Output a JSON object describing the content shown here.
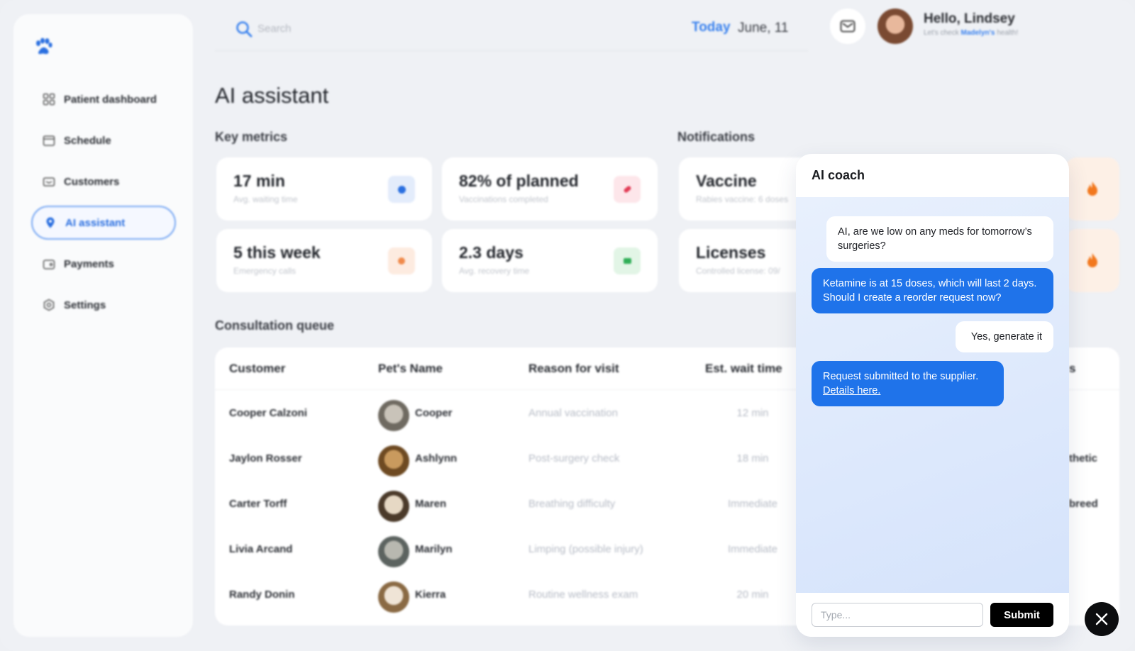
{
  "sidebar": {
    "items": [
      {
        "label": "Patient dashboard",
        "icon": "grid-icon"
      },
      {
        "label": "Schedule",
        "icon": "calendar-icon"
      },
      {
        "label": "Customers",
        "icon": "customers-icon"
      },
      {
        "label": "AI assistant",
        "icon": "pin-icon",
        "active": true
      },
      {
        "label": "Payments",
        "icon": "wallet-icon"
      },
      {
        "label": "Settings",
        "icon": "gear-icon"
      }
    ]
  },
  "topbar": {
    "search_placeholder": "Search",
    "today_label": "Today",
    "date": "June, 11",
    "greeting": "Hello, Lindsey",
    "sub_prefix": "Let's check ",
    "sub_pet": "Madelyn's",
    "sub_suffix": " health!"
  },
  "page": {
    "title": "AI assistant",
    "key_metrics_label": "Key metrics",
    "notifications_label": "Notifications",
    "queue_label": "Consultation queue"
  },
  "metrics": [
    {
      "value": "17 min",
      "label": "Avg. waiting time"
    },
    {
      "value": "82% of planned",
      "label": "Vaccinations completed"
    },
    {
      "value": "5 this week",
      "label": "Emergency calls"
    },
    {
      "value": "2.3 days",
      "label": "Avg. recovery time"
    }
  ],
  "notifications": [
    {
      "title": "Vaccine",
      "detail": "Rabies vaccine: 6 doses"
    },
    {
      "title": "Licenses",
      "detail": "Controlled license: 09/"
    }
  ],
  "queue": {
    "headers": [
      "Customer",
      "Pet's Name",
      "Reason for visit",
      "Est. wait time"
    ],
    "header_partial": "s",
    "rows": [
      {
        "customer": "Cooper Calzoni",
        "pet": "Cooper",
        "reason": "Annual vaccination",
        "wait": "12 min"
      },
      {
        "customer": "Jaylon Rosser",
        "pet": "Ashlynn",
        "reason": "Post-surgery check",
        "wait": "18 min"
      },
      {
        "customer": "Carter Torff",
        "pet": "Maren",
        "reason": "Breathing difficulty",
        "wait": "Immediate"
      },
      {
        "customer": "Livia Arcand",
        "pet": "Marilyn",
        "reason": "Limping (possible injury)",
        "wait": "Immediate"
      },
      {
        "customer": "Randy Donin",
        "pet": "Kierra",
        "reason": "Routine wellness exam",
        "wait": "20 min"
      }
    ],
    "partial_cells": [
      "thetic",
      "breed"
    ]
  },
  "coach": {
    "title": "AI coach",
    "messages": [
      {
        "from": "user",
        "text": "AI, are we low on any meds for tomorrow’s surgeries?"
      },
      {
        "from": "bot",
        "text": "Ketamine is at 15 doses, which will last 2 days. Should I create a reorder request now?"
      },
      {
        "from": "user",
        "text": "Yes, generate it"
      },
      {
        "from": "bot",
        "text": "Request submitted to the supplier.",
        "link": "Details here."
      }
    ],
    "input_placeholder": "Type...",
    "submit_label": "Submit"
  },
  "colors": {
    "accent": "#1f73ea",
    "brand": "#3a82ee",
    "submit": "#000000"
  }
}
